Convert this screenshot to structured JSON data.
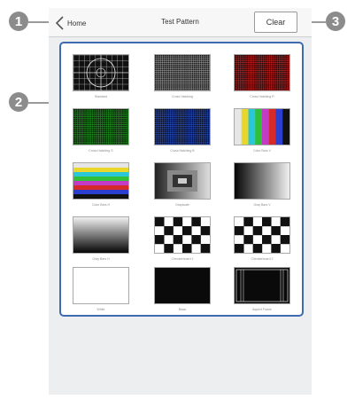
{
  "callouts": [
    "1",
    "2",
    "3"
  ],
  "header": {
    "back_label": "Home",
    "title": "Test Pattern",
    "clear_label": "Clear"
  },
  "patterns": [
    {
      "label": "Standard",
      "kind": "standard"
    },
    {
      "label": "Cross Hatching",
      "kind": "hatch-white"
    },
    {
      "label": "Cross Hatching R",
      "kind": "hatch-red"
    },
    {
      "label": "Cross Hatching G",
      "kind": "hatch-green"
    },
    {
      "label": "Cross Hatching B",
      "kind": "hatch-blue"
    },
    {
      "label": "Color Bars V",
      "kind": "bars-v"
    },
    {
      "label": "Color Bars H",
      "kind": "bars-h"
    },
    {
      "label": "Grayscale",
      "kind": "grayscale"
    },
    {
      "label": "Gray Bars V",
      "kind": "gray-v"
    },
    {
      "label": "Gray Bars H",
      "kind": "gray-h"
    },
    {
      "label": "Checkerboard 1",
      "kind": "checker-1"
    },
    {
      "label": "Checkerboard 2",
      "kind": "checker-2"
    },
    {
      "label": "White",
      "kind": "white"
    },
    {
      "label": "Black",
      "kind": "black"
    },
    {
      "label": "Aspect Frame",
      "kind": "aspect"
    }
  ],
  "colors": {
    "panel_border": "#3d6ab0",
    "red_hatch": "#d42020",
    "green_hatch": "#25a025",
    "blue_hatch": "#2a52c8"
  }
}
